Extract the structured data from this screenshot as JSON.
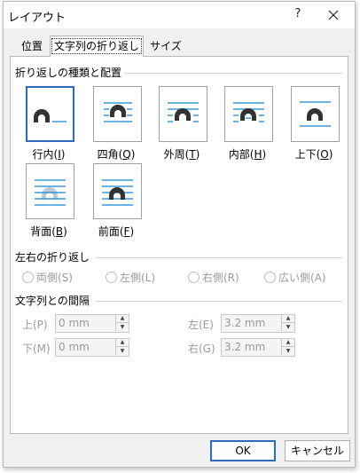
{
  "window": {
    "title": "レイアウト",
    "help_glyph": "?"
  },
  "tabs": [
    {
      "label": "位置"
    },
    {
      "label": "文字列の折り返し"
    },
    {
      "label": "サイズ"
    }
  ],
  "wrap_section": {
    "title": "折り返しの種類と配置",
    "options": [
      {
        "label": "行内(",
        "key": "I",
        "icon": "inline-wrap-icon"
      },
      {
        "label": "四角(",
        "key": "Q",
        "icon": "square-wrap-icon"
      },
      {
        "label": "外周(",
        "key": "T",
        "icon": "tight-wrap-icon"
      },
      {
        "label": "内部(",
        "key": "H",
        "icon": "through-wrap-icon"
      },
      {
        "label": "上下(",
        "key": "O",
        "icon": "top-bottom-wrap-icon"
      },
      {
        "label": "背面(",
        "key": "B",
        "icon": "behind-text-icon"
      },
      {
        "label": "前面(",
        "key": "F",
        "icon": "in-front-of-text-icon"
      }
    ],
    "accent_color": "#3a9ad9",
    "shape_color": "#333333"
  },
  "side_section": {
    "title": "左右の折り返し",
    "options": [
      "両側(S)",
      "左側(L)",
      "右側(R)",
      "広い側(A)"
    ]
  },
  "distance_section": {
    "title": "文字列との間隔",
    "top_label": "上(P)",
    "top_value": "0 mm",
    "bottom_label": "下(M)",
    "bottom_value": "0 mm",
    "left_label": "左(E)",
    "left_value": "3.2 mm",
    "right_label": "右(G)",
    "right_value": "3.2 mm"
  },
  "buttons": {
    "ok": "OK",
    "cancel": "キャンセル"
  },
  "colors": {
    "selection": "#2a6cc0",
    "dialog_bg": "#f0f0f0"
  }
}
